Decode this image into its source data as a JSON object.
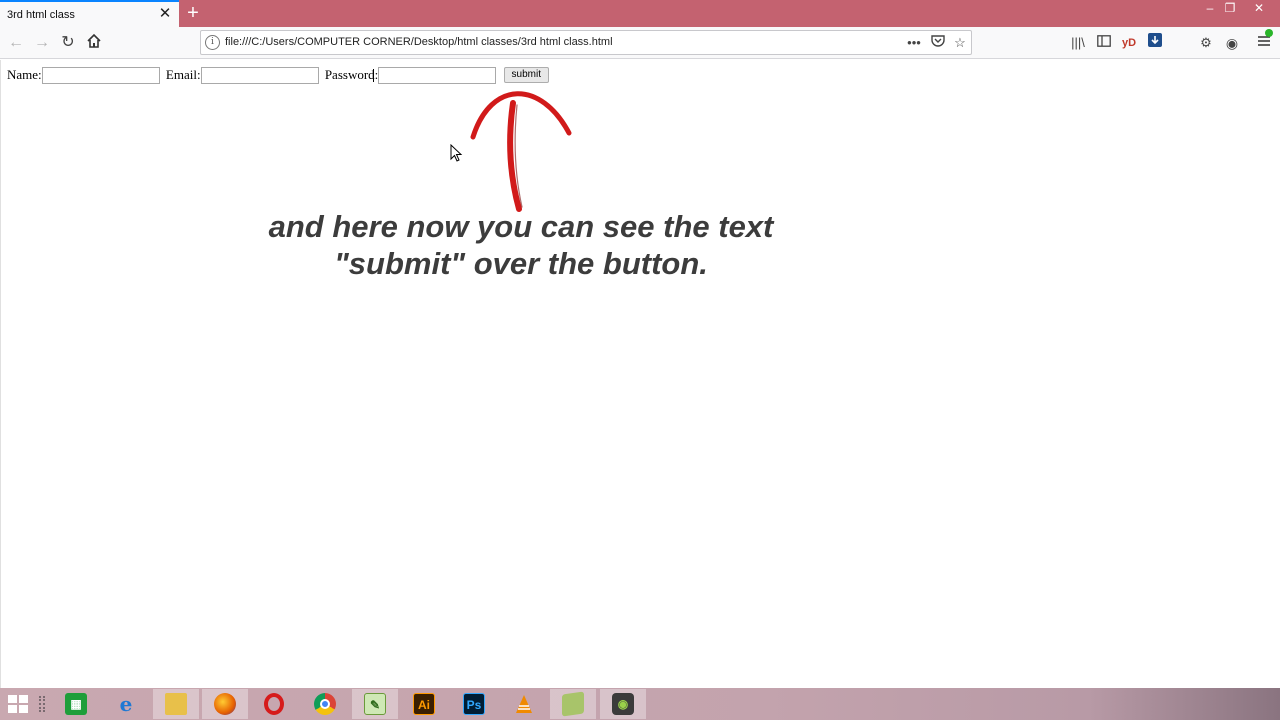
{
  "browser": {
    "tab": {
      "title": "3rd html class"
    },
    "url": "file:///C:/Users/COMPUTER CORNER/Desktop/html classes/3rd html class.html",
    "toolbar": {
      "yd_label": "yD"
    }
  },
  "form": {
    "name_label": "Name:",
    "email_label": "Email:",
    "password_label": "Password:",
    "submit_label": "submit"
  },
  "annotation": {
    "line1": "and here now you can see the text",
    "line2": "\"submit\" over the button."
  },
  "taskbar": {
    "items": [
      "file-manager-icon",
      "internet-explorer-icon",
      "folder-icon",
      "firefox-icon",
      "opera-icon",
      "chrome-icon",
      "notepad-plus-plus-icon",
      "illustrator-icon",
      "photoshop-icon",
      "vlc-icon",
      "app-icon",
      "camera-recorder-icon"
    ],
    "illustrator_label": "Ai",
    "photoshop_label": "Ps"
  },
  "colors": {
    "tabstrip": "#c46270",
    "tab_accent": "#0a84ff",
    "arrow": "#d11a1a",
    "annotation_text": "#3c3c3c"
  }
}
